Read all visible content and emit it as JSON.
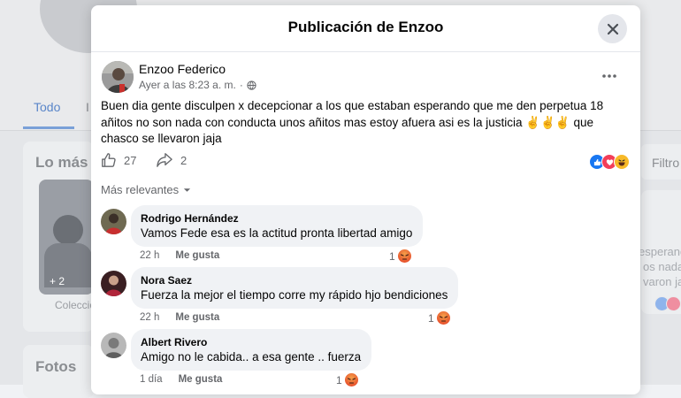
{
  "modal": {
    "title": "Publicación de Enzoo"
  },
  "post": {
    "author": "Enzoo Federico",
    "timestamp": "Ayer a las 8:23 a. m.",
    "separator": "·",
    "privacy_icon": "globe-icon",
    "text": "Buen dia gente disculpen x decepcionar a los que estaban esperando que me den perpetua 18 añitos no son nada con conducta unos añitos mas estoy afuera asi es la justicia ✌️✌️✌️ que chasco se llevaron jaja",
    "likes": "27",
    "shares": "2",
    "reaction_types": [
      "like",
      "love",
      "haha"
    ]
  },
  "comments_sort": "Más relevantes",
  "comments": [
    {
      "name": "Rodrigo Hernández",
      "text": "Vamos Fede esa es la actitud pronta libertad amigo",
      "time": "22 h",
      "like_label": "Me gusta",
      "reactions": "1",
      "reaction_type": "angry"
    },
    {
      "name": "Nora Saez",
      "text": "Fuerza la mejor el tiempo corre my rápido hjo bendiciones",
      "time": "22 h",
      "like_label": "Me gusta",
      "reactions": "1",
      "reaction_type": "angry"
    },
    {
      "name": "Albert Rivero",
      "text": "Amigo no le cabida.. a esa gente .. fuerza",
      "time": "1 día",
      "like_label": "Me gusta",
      "reactions": "1",
      "reaction_type": "angry"
    }
  ],
  "background": {
    "tab_active": "Todo",
    "section_title": "Lo más",
    "photo_count": "+ 2",
    "collection_label": "Coleccio",
    "photos_title": "Fotos",
    "filter_label": "Filtro",
    "right_snippets": [
      "esperando",
      "os nada",
      "varon jaja"
    ]
  },
  "colors": {
    "accent": "#1877f2",
    "bubble": "#f0f2f5",
    "secondary_text": "#65676b"
  }
}
